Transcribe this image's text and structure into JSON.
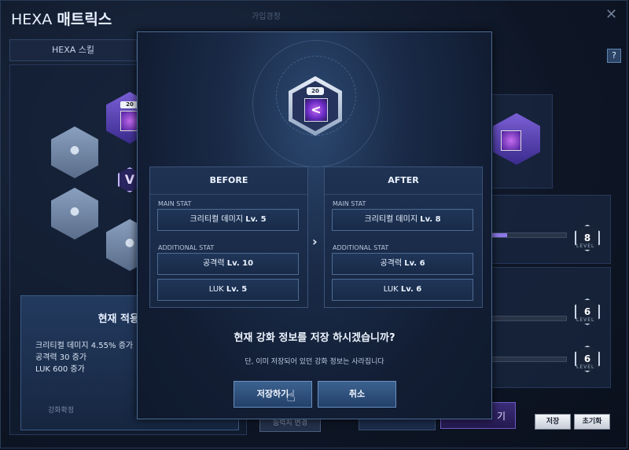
{
  "window": {
    "title_prefix": "HEXA",
    "title_main": "매트릭스",
    "close_glyph": "✕",
    "help_glyph": "?"
  },
  "tabs": {
    "skill_tab": "HEXA 스킬",
    "bg_tab": "가입경정"
  },
  "left": {
    "current_title": "현재 적용 중인",
    "current_lines": [
      "크리티컬 데미지 4.55% 증가",
      "공격력 30 증가",
      "LUK 600 증가"
    ],
    "bottom_label": "강화확정",
    "skill_level": "20"
  },
  "right": {
    "level_label": "LEVEL",
    "levels": [
      "8",
      "6",
      "6"
    ],
    "save_button": "저장",
    "reset_button": "초기화",
    "bg_button": "능력치 변경",
    "bg_button2": "기"
  },
  "modal": {
    "skill_level": "20",
    "skill_glyph": "<",
    "before": {
      "title": "BEFORE",
      "main_stat_label": "MAIN STAT",
      "main_stat_name": "크리티컬 데미지",
      "main_stat_level": "Lv. 5",
      "additional_label": "ADDITIONAL STAT",
      "add1_name": "공격력",
      "add1_level": "Lv. 10",
      "add2_name": "LUK",
      "add2_level": "Lv. 5"
    },
    "after": {
      "title": "AFTER",
      "main_stat_label": "MAIN STAT",
      "main_stat_name": "크리티컬 데미지",
      "main_stat_level": "Lv. 8",
      "additional_label": "ADDITIONAL STAT",
      "add1_name": "공격력",
      "add1_level": "Lv. 6",
      "add2_name": "LUK",
      "add2_level": "Lv. 6"
    },
    "arrow_glyph": "›",
    "question": "현재 강화 정보를 저장 하시겠습니까?",
    "note": "단, 이미 저장되어 있던 강화 정보는 사라집니다",
    "confirm_button": "저장하기",
    "cancel_button": "취소"
  },
  "colors": {
    "accent": "#8e79e8",
    "panel": "#1a2b48",
    "border": "#4b6a93"
  },
  "icons": [
    "close-icon",
    "help-icon",
    "lock-icon",
    "v-matrix-icon",
    "skill-icon",
    "arrow-right-icon",
    "hand-cursor-icon"
  ]
}
